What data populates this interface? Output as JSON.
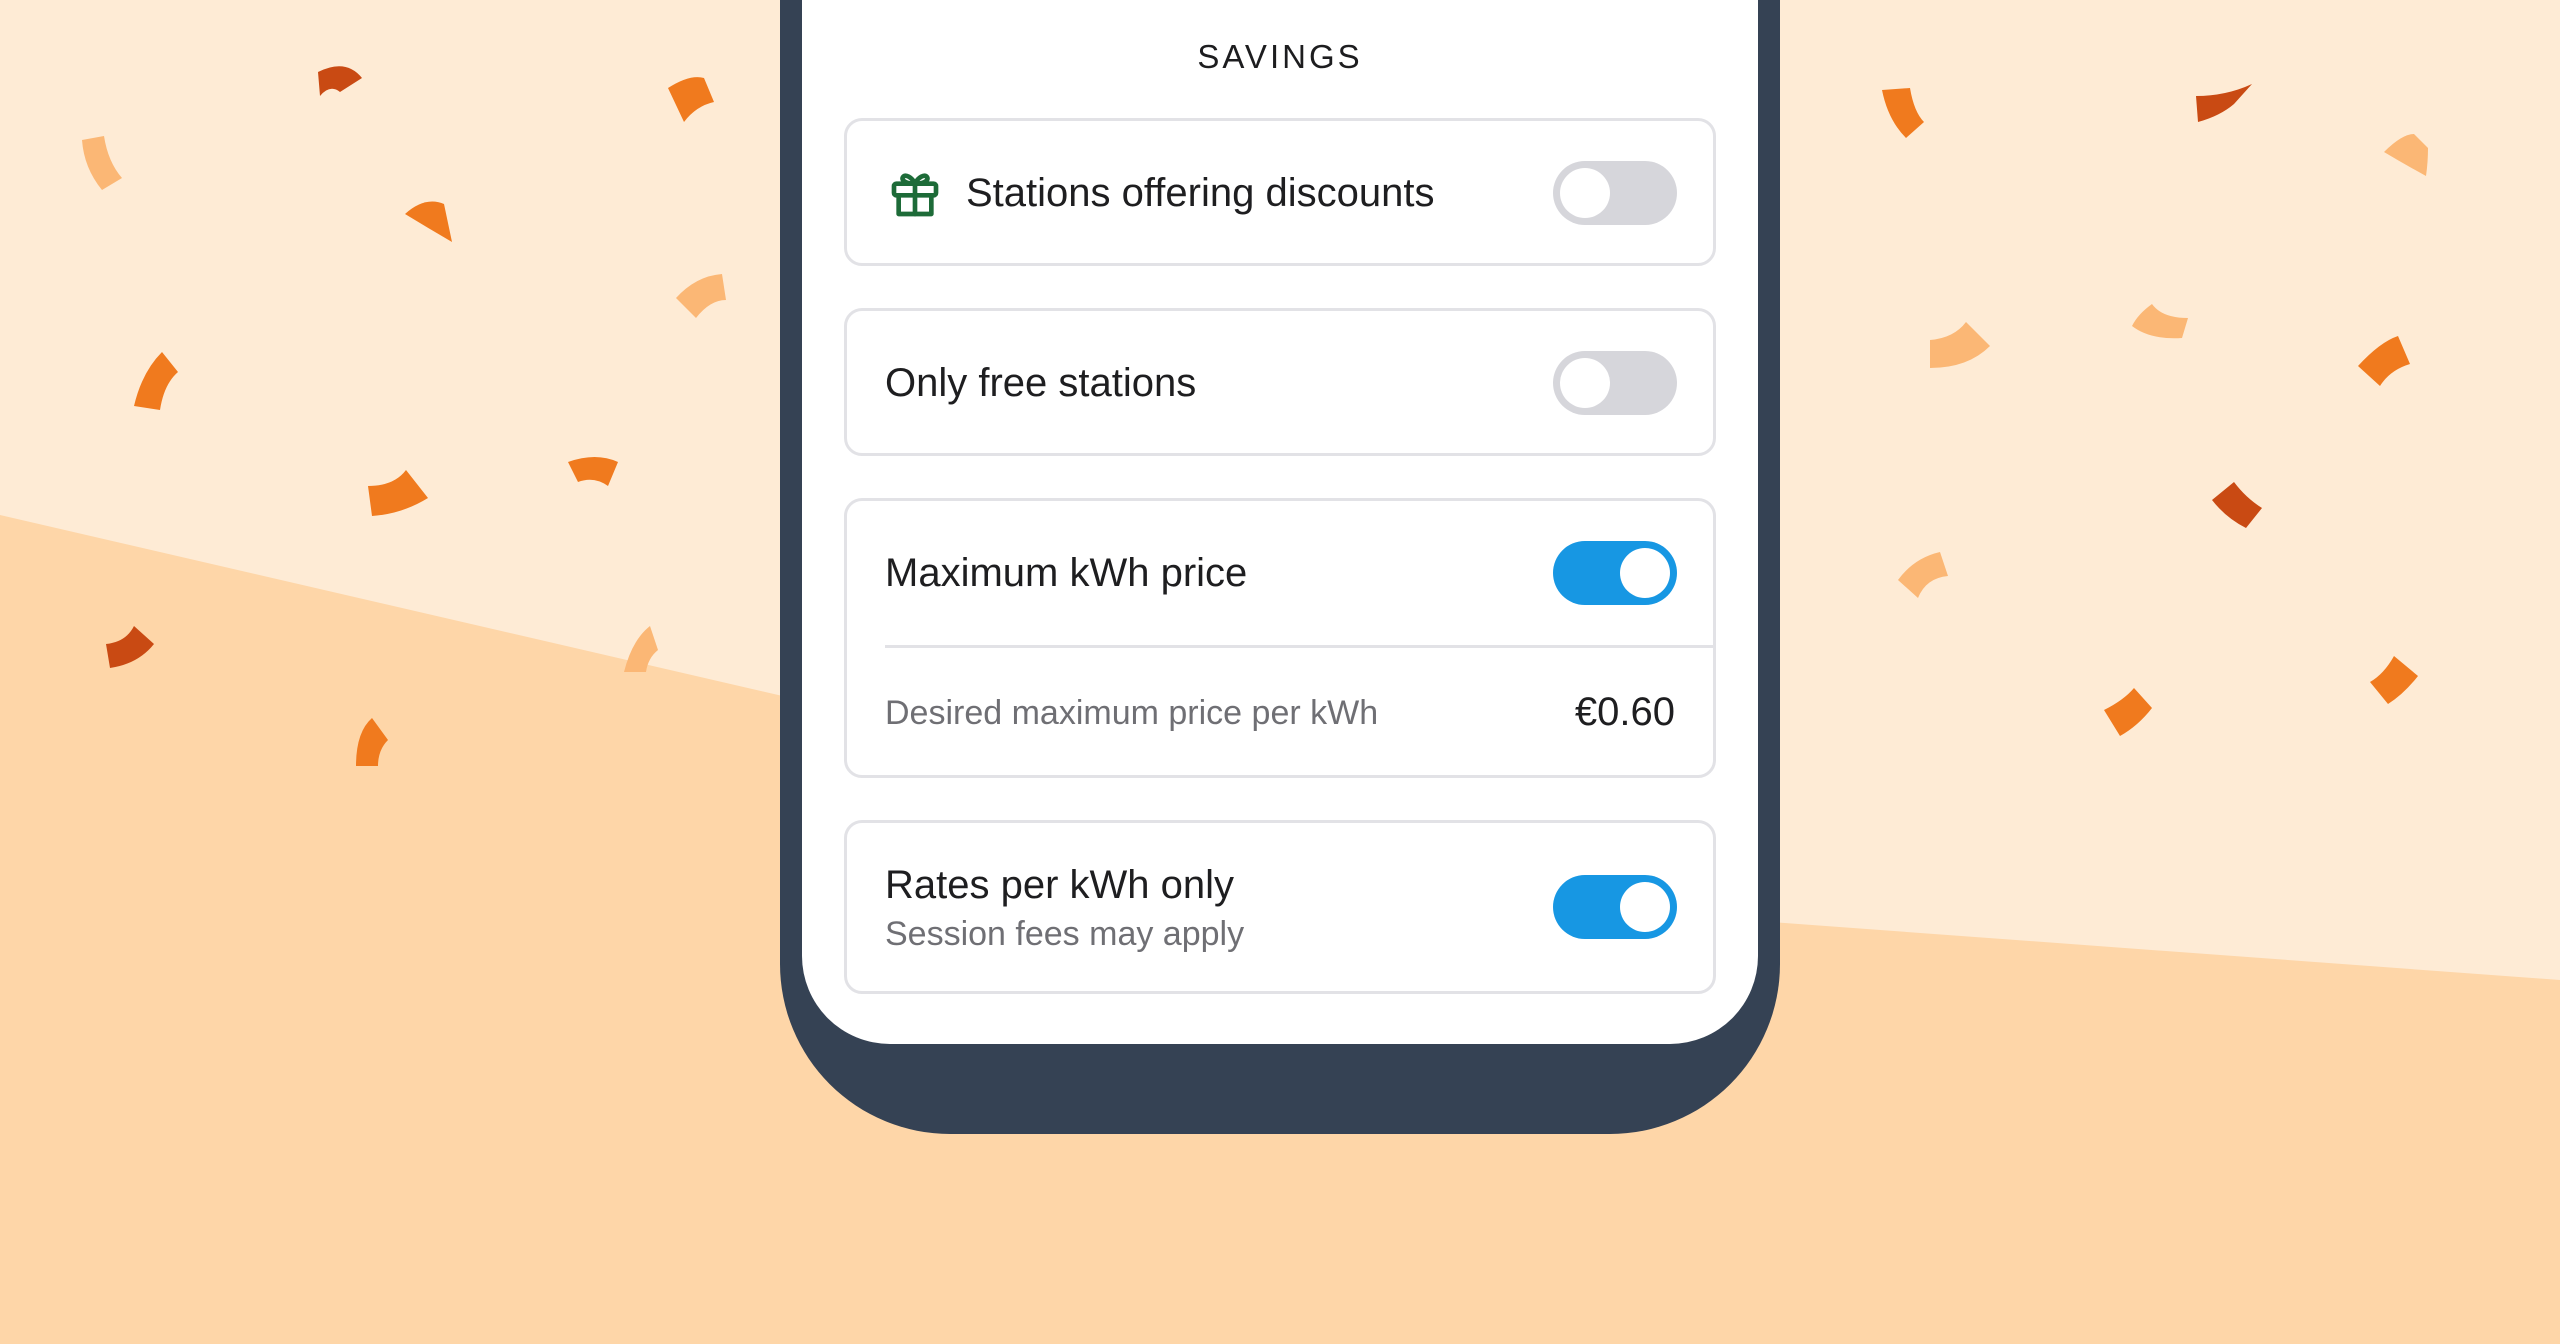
{
  "section": {
    "title": "SAVINGS"
  },
  "filters": [
    {
      "label": "Stations offering discounts",
      "icon": "gift-icon",
      "enabled": false
    },
    {
      "label": "Only free stations",
      "enabled": false
    },
    {
      "label": "Maximum kWh price",
      "enabled": true,
      "detail_label": "Desired maximum price per kWh",
      "detail_value": "€0.60"
    },
    {
      "label": "Rates per kWh only",
      "sublabel": "Session fees may apply",
      "enabled": true
    }
  ],
  "colors": {
    "toggle_on": "#1797e3",
    "toggle_off": "#d6d6db",
    "gift_icon": "#1d6b38",
    "phone_frame": "#354254",
    "background_light": "#feebd5",
    "background_dark": "#fed6a8",
    "confetti": [
      "#f07a1e",
      "#c94a13",
      "#fbb775"
    ]
  }
}
